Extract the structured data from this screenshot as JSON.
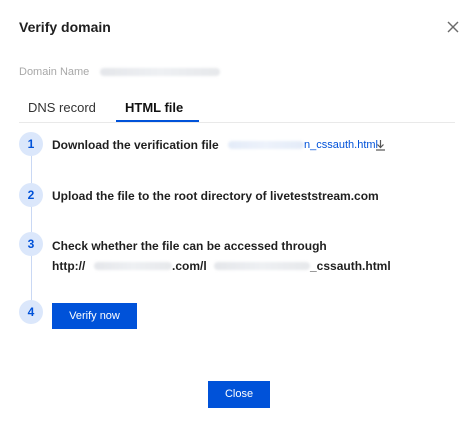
{
  "dialog": {
    "title": "Verify domain"
  },
  "domain_field": {
    "label": "Domain Name"
  },
  "tabs": [
    {
      "label": "DNS record",
      "active": false
    },
    {
      "label": "HTML file",
      "active": true
    }
  ],
  "steps": [
    {
      "number": "1",
      "text": "Download the verification file",
      "file_link_suffix": "n_cssauth.html"
    },
    {
      "number": "2",
      "text": "Upload the file to the root directory of liveteststream.com"
    },
    {
      "number": "3",
      "text": "Check whether the file can be accessed through",
      "url_prefix": "http://",
      "url_middle": ".com/l",
      "url_suffix": "_cssauth.html"
    },
    {
      "number": "4",
      "button_label": "Verify now"
    }
  ],
  "footer": {
    "close_label": "Close"
  },
  "colors": {
    "accent": "#0052d9",
    "step_circle_bg": "#dbe7fb"
  },
  "icons": {
    "close": "close-icon",
    "download": "download-icon"
  }
}
